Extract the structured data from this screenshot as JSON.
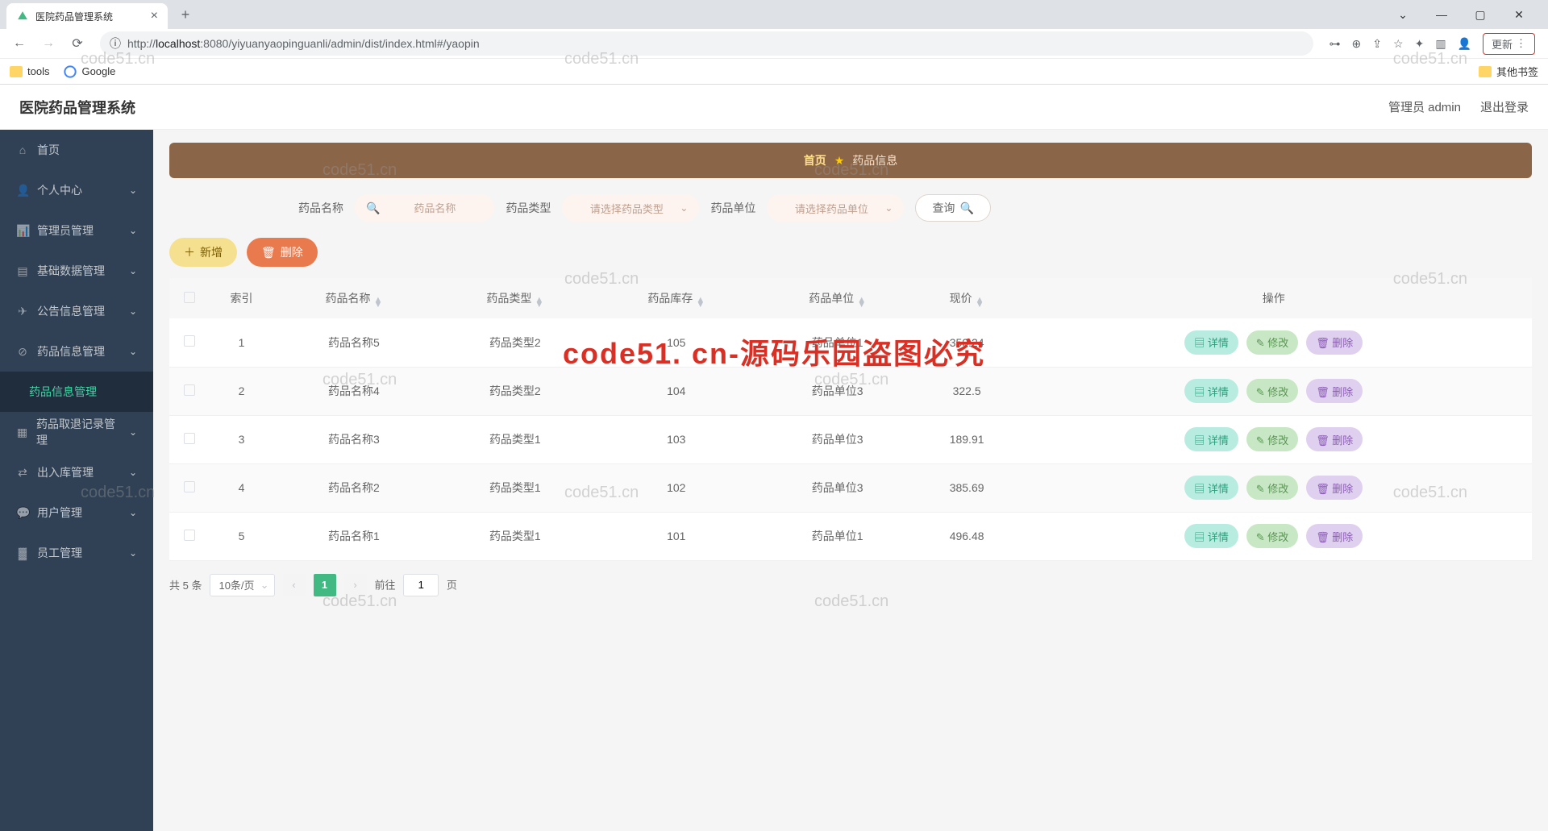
{
  "browser": {
    "tab_title": "医院药品管理系统",
    "url_scheme": "http://",
    "url_host": "localhost",
    "url_port": ":8080",
    "url_path": "/yiyuanyaopinguanli/admin/dist/index.html#/yaopin",
    "update_label": "更新",
    "bookmarks": {
      "tools": "tools",
      "google": "Google",
      "other": "其他书签"
    }
  },
  "app": {
    "title": "医院药品管理系统",
    "admin_label": "管理员 admin",
    "logout_label": "退出登录"
  },
  "sidebar": {
    "items": [
      {
        "icon": "home",
        "label": "首页"
      },
      {
        "icon": "user",
        "label": "个人中心"
      },
      {
        "icon": "chart",
        "label": "管理员管理"
      },
      {
        "icon": "data",
        "label": "基础数据管理"
      },
      {
        "icon": "notice",
        "label": "公告信息管理"
      },
      {
        "icon": "drug",
        "label": "药品信息管理"
      },
      {
        "icon": "return",
        "label": "药品取退记录管理"
      },
      {
        "icon": "stock",
        "label": "出入库管理"
      },
      {
        "icon": "users",
        "label": "用户管理"
      },
      {
        "icon": "staff",
        "label": "员工管理"
      }
    ],
    "active_sub": "药品信息管理"
  },
  "breadcrumb": {
    "home": "首页",
    "current": "药品信息"
  },
  "search": {
    "name_label": "药品名称",
    "name_placeholder": "药品名称",
    "type_label": "药品类型",
    "type_placeholder": "请选择药品类型",
    "unit_label": "药品单位",
    "unit_placeholder": "请选择药品单位",
    "query_label": "查询"
  },
  "actions": {
    "add": "新增",
    "batch_delete": "删除"
  },
  "table": {
    "headers": [
      "索引",
      "药品名称",
      "药品类型",
      "药品库存",
      "药品单位",
      "现价",
      "操作"
    ],
    "op_labels": {
      "detail": "详情",
      "edit": "修改",
      "delete": "删除"
    },
    "rows": [
      {
        "idx": "1",
        "name": "药品名称5",
        "type": "药品类型2",
        "stock": "105",
        "unit": "药品单位1",
        "price": "350.24"
      },
      {
        "idx": "2",
        "name": "药品名称4",
        "type": "药品类型2",
        "stock": "104",
        "unit": "药品单位3",
        "price": "322.5"
      },
      {
        "idx": "3",
        "name": "药品名称3",
        "type": "药品类型1",
        "stock": "103",
        "unit": "药品单位3",
        "price": "189.91"
      },
      {
        "idx": "4",
        "name": "药品名称2",
        "type": "药品类型1",
        "stock": "102",
        "unit": "药品单位3",
        "price": "385.69"
      },
      {
        "idx": "5",
        "name": "药品名称1",
        "type": "药品类型1",
        "stock": "101",
        "unit": "药品单位1",
        "price": "496.48"
      }
    ]
  },
  "pagination": {
    "total_label": "共 5 条",
    "page_size": "10条/页",
    "current_page": "1",
    "jump_prefix": "前往",
    "jump_value": "1",
    "jump_suffix": "页"
  },
  "watermark": "code51.cn",
  "red_watermark": "code51. cn-源码乐园盗图必究"
}
